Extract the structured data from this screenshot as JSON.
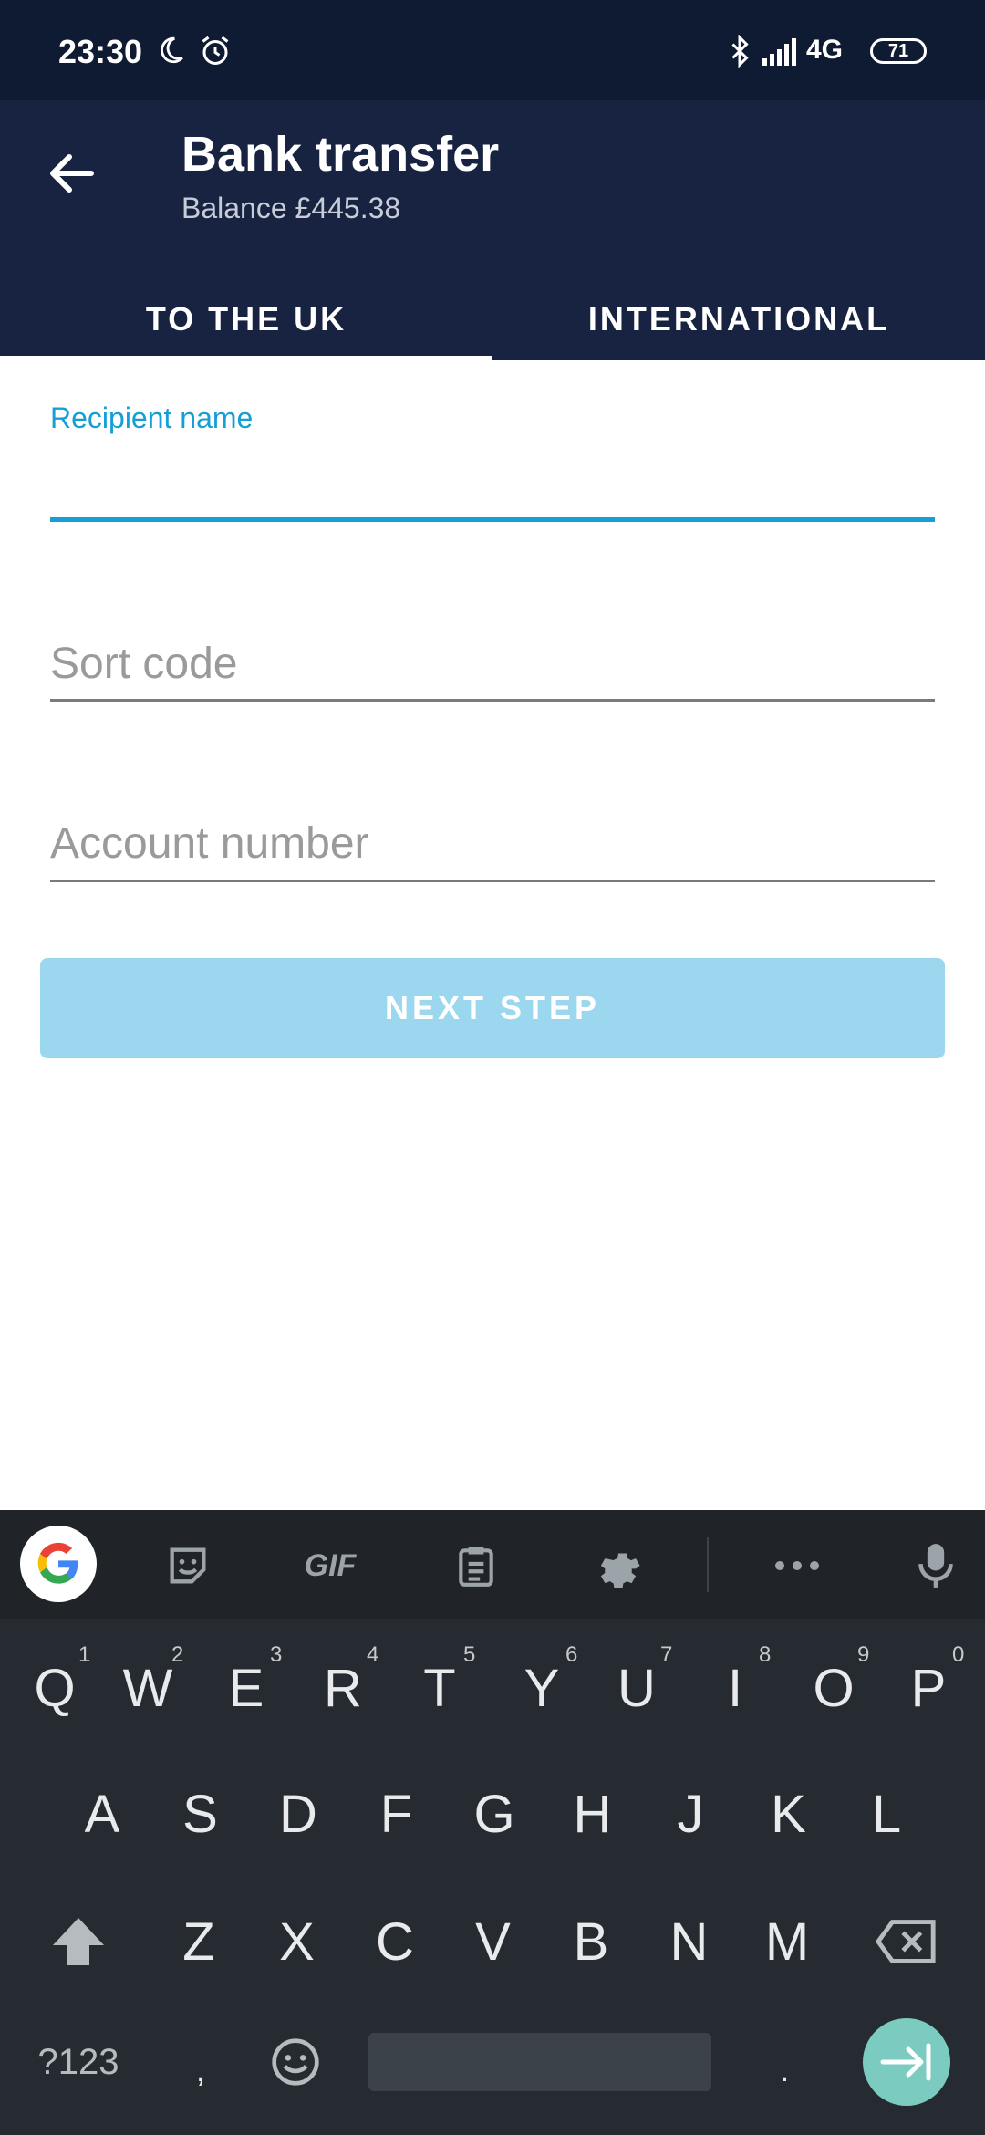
{
  "status_bar": {
    "time": "23:30",
    "battery": "71",
    "network": "4G"
  },
  "app_bar": {
    "title": "Bank transfer",
    "subtitle": "Balance £445.38"
  },
  "tabs": [
    {
      "label": "TO THE UK"
    },
    {
      "label": "INTERNATIONAL"
    }
  ],
  "form": {
    "recipient_label": "Recipient name",
    "recipient_value": "",
    "sort_code_placeholder": "Sort code",
    "account_number_placeholder": "Account number",
    "next_button": "NEXT STEP"
  },
  "keyboard": {
    "row1": [
      {
        "k": "Q",
        "n": "1"
      },
      {
        "k": "W",
        "n": "2"
      },
      {
        "k": "E",
        "n": "3"
      },
      {
        "k": "R",
        "n": "4"
      },
      {
        "k": "T",
        "n": "5"
      },
      {
        "k": "Y",
        "n": "6"
      },
      {
        "k": "U",
        "n": "7"
      },
      {
        "k": "I",
        "n": "8"
      },
      {
        "k": "O",
        "n": "9"
      },
      {
        "k": "P",
        "n": "0"
      }
    ],
    "row2": [
      "A",
      "S",
      "D",
      "F",
      "G",
      "H",
      "J",
      "K",
      "L"
    ],
    "row3": [
      "Z",
      "X",
      "C",
      "V",
      "B",
      "N",
      "M"
    ],
    "symbols_key": "?123",
    "comma_key": ",",
    "period_key": ".",
    "gif_label": "GIF"
  },
  "colors": {
    "accent": "#169fd6",
    "header": "#172340",
    "button_disabled": "#9bd8ef"
  }
}
